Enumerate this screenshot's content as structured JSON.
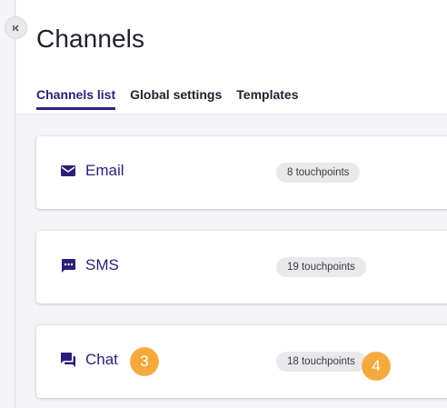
{
  "page": {
    "title": "Channels"
  },
  "tabs": [
    {
      "label": "Channels list"
    },
    {
      "label": "Global settings"
    },
    {
      "label": "Templates"
    }
  ],
  "channels": [
    {
      "name": "Email",
      "icon": "mail-icon",
      "touchpoints": "8 touchpoints"
    },
    {
      "name": "SMS",
      "icon": "sms-icon",
      "touchpoints": "19 touchpoints"
    },
    {
      "name": "Chat",
      "icon": "chat-icon",
      "touchpoints": "18 touchpoints"
    }
  ],
  "markers": [
    "3",
    "4"
  ],
  "colors": {
    "accent": "#2f1f8f",
    "marker": "#f6a93b",
    "badge_bg": "#e9e9ec"
  }
}
